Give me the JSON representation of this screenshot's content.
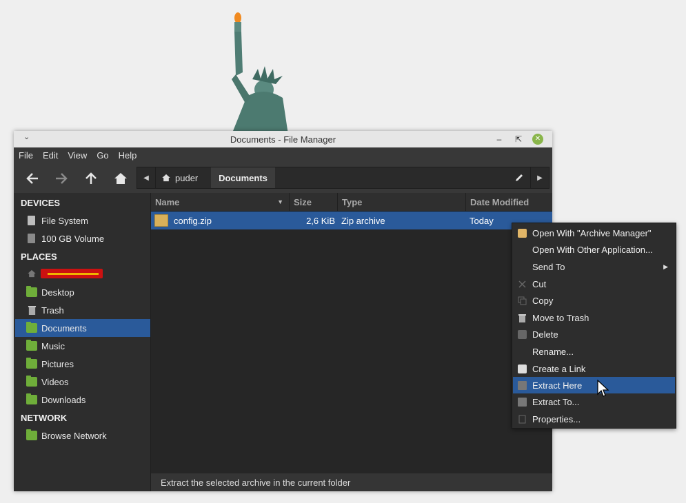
{
  "window": {
    "title": "Documents - File Manager",
    "menu_icon": "chevron-down-icon",
    "controls": [
      "minimize-icon",
      "restore-icon",
      "close-icon"
    ]
  },
  "menubar": [
    "File",
    "Edit",
    "View",
    "Go",
    "Help"
  ],
  "toolbar": {
    "buttons": [
      "back-arrow-icon",
      "forward-arrow-icon",
      "up-arrow-icon",
      "home-icon"
    ],
    "path": [
      "puder",
      "Documents"
    ]
  },
  "sidebar": {
    "sections": [
      {
        "heading": "DEVICES",
        "items": [
          {
            "label": "File System",
            "icon": "drive-icon"
          },
          {
            "label": "100 GB Volume",
            "icon": "drive-icon"
          }
        ]
      },
      {
        "heading": "PLACES",
        "items": [
          {
            "label": "",
            "icon": "home-icon",
            "redacted": true
          },
          {
            "label": "Desktop",
            "icon": "folder-icon"
          },
          {
            "label": "Trash",
            "icon": "trash-icon"
          },
          {
            "label": "Documents",
            "icon": "folder-icon",
            "selected": true
          },
          {
            "label": "Music",
            "icon": "folder-icon"
          },
          {
            "label": "Pictures",
            "icon": "folder-icon"
          },
          {
            "label": "Videos",
            "icon": "folder-icon"
          },
          {
            "label": "Downloads",
            "icon": "folder-icon"
          }
        ]
      },
      {
        "heading": "NETWORK",
        "items": [
          {
            "label": "Browse Network",
            "icon": "network-icon"
          }
        ]
      }
    ]
  },
  "columns": [
    "Name",
    "Size",
    "Type",
    "Date Modified"
  ],
  "files": [
    {
      "name": "config.zip",
      "size": "2,6 KiB",
      "type": "Zip archive",
      "modified": "Today",
      "selected": true
    }
  ],
  "status": "Extract the selected archive in the current folder",
  "context_menu": {
    "items": [
      {
        "label": "Open With \"Archive Manager\"",
        "icon": "archive-icon"
      },
      {
        "label": "Open With Other Application...",
        "icon": ""
      },
      {
        "label": "Send To",
        "icon": "",
        "submenu": true
      },
      {
        "label": "Cut",
        "icon": "cut-icon"
      },
      {
        "label": "Copy",
        "icon": "copy-icon"
      },
      {
        "label": "Move to Trash",
        "icon": "trash-icon"
      },
      {
        "label": "Delete",
        "icon": "delete-icon"
      },
      {
        "label": "Rename...",
        "icon": ""
      },
      {
        "label": "Create a Link",
        "icon": "link-icon"
      },
      {
        "label": "Extract Here",
        "icon": "extract-icon",
        "selected": true
      },
      {
        "label": "Extract To...",
        "icon": "extract-icon"
      },
      {
        "label": "Properties...",
        "icon": "properties-icon"
      }
    ]
  },
  "colors": {
    "accent": "#2a5a9a",
    "folder": "#6fae3a",
    "close": "#89b54a"
  }
}
